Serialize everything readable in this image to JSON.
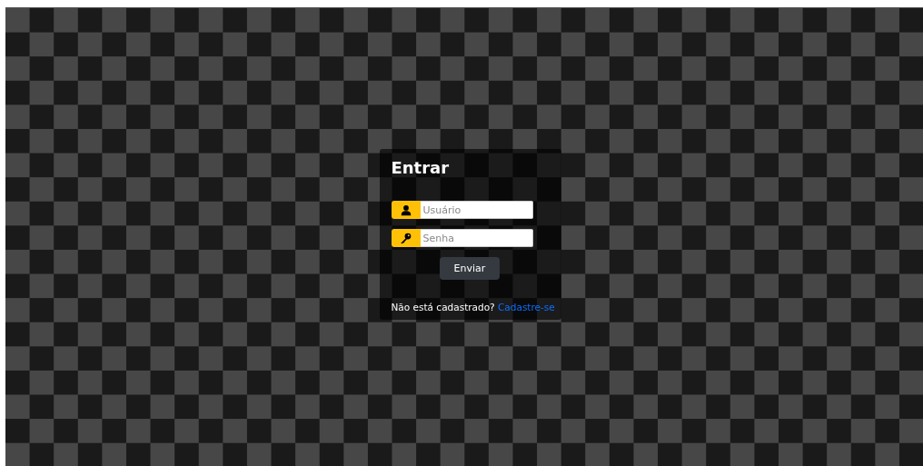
{
  "title": "Entrar",
  "fields": [
    {
      "kind": "user",
      "placeholder": "Usuário"
    },
    {
      "kind": "password",
      "placeholder": "Senha"
    }
  ],
  "submit": "Enviar",
  "signup": {
    "prompt": "Não está cadastrado?",
    "link": "Cadastre-se"
  }
}
